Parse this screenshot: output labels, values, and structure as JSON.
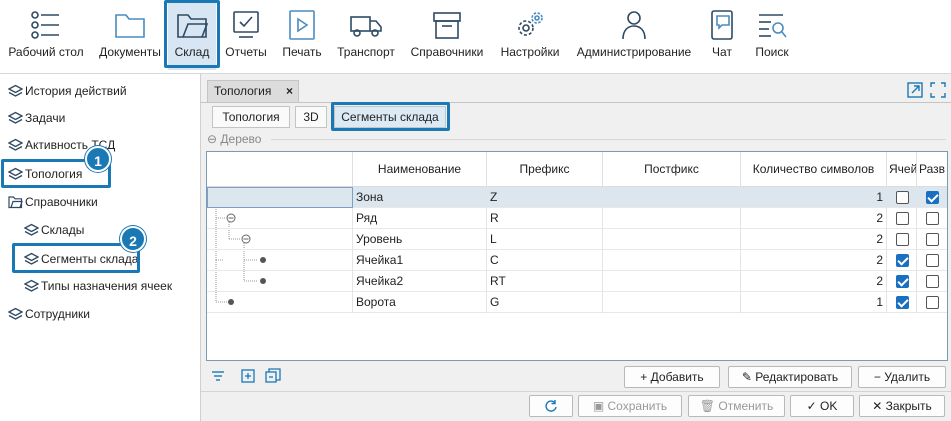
{
  "toolbar": {
    "items": [
      {
        "label": "Рабочий стол",
        "icon": "desktop-list-icon"
      },
      {
        "label": "Документы",
        "icon": "folder-icon"
      },
      {
        "label": "Склад",
        "icon": "warehouse-folder-icon"
      },
      {
        "label": "Отчеты",
        "icon": "report-monitor-icon"
      },
      {
        "label": "Печать",
        "icon": "print-play-icon"
      },
      {
        "label": "Транспорт",
        "icon": "truck-icon"
      },
      {
        "label": "Справочники",
        "icon": "box-icon"
      },
      {
        "label": "Настройки",
        "icon": "gears-icon"
      },
      {
        "label": "Администрирование",
        "icon": "user-icon"
      },
      {
        "label": "Чат",
        "icon": "chat-icon"
      },
      {
        "label": "Поиск",
        "icon": "search-list-icon"
      }
    ]
  },
  "sidebar": {
    "items": [
      {
        "label": "История действий"
      },
      {
        "label": "Задачи"
      },
      {
        "label": "Активность ТСД"
      },
      {
        "label": "Топология"
      },
      {
        "label": "Справочники"
      },
      {
        "label": "Склады"
      },
      {
        "label": "Сегменты склада"
      },
      {
        "label": "Типы назначения ячеек"
      },
      {
        "label": "Сотрудники"
      }
    ],
    "badges": [
      "1",
      "2"
    ]
  },
  "doc_tab": {
    "label": "Топология",
    "close": "×"
  },
  "sub_tabs": [
    "Топология",
    "3D",
    "Сегменты склада"
  ],
  "group_title": "Дерево",
  "group_toggle": "⊖",
  "grid": {
    "columns": [
      "Наименование",
      "Префикс",
      "Постфикс",
      "Количество символов",
      "Ячей",
      "Разв"
    ],
    "rows": [
      {
        "name": "Зона",
        "prefix": "Z",
        "postfix": "",
        "count": "1",
        "cell": false,
        "develop": true
      },
      {
        "name": "Ряд",
        "prefix": "R",
        "postfix": "",
        "count": "2",
        "cell": false,
        "develop": false
      },
      {
        "name": "Уровень",
        "prefix": "L",
        "postfix": "",
        "count": "2",
        "cell": false,
        "develop": false
      },
      {
        "name": "Ячейка1",
        "prefix": "C",
        "postfix": "",
        "count": "2",
        "cell": true,
        "develop": false
      },
      {
        "name": "Ячейка2",
        "prefix": "RT",
        "postfix": "",
        "count": "2",
        "cell": true,
        "develop": false
      },
      {
        "name": "Ворота",
        "prefix": "G",
        "postfix": "",
        "count": "1",
        "cell": true,
        "develop": false
      }
    ]
  },
  "actions": {
    "add": "Добавить",
    "edit": "Редактировать",
    "delete": "Удалить"
  },
  "footer": {
    "save": "Сохранить",
    "cancel": "Отменить",
    "ok": "OK",
    "close": "Закрыть"
  },
  "colors": {
    "accent": "#1a79b5",
    "selected_row": "#dce6ef",
    "checkbox": "#1a6fc0"
  }
}
